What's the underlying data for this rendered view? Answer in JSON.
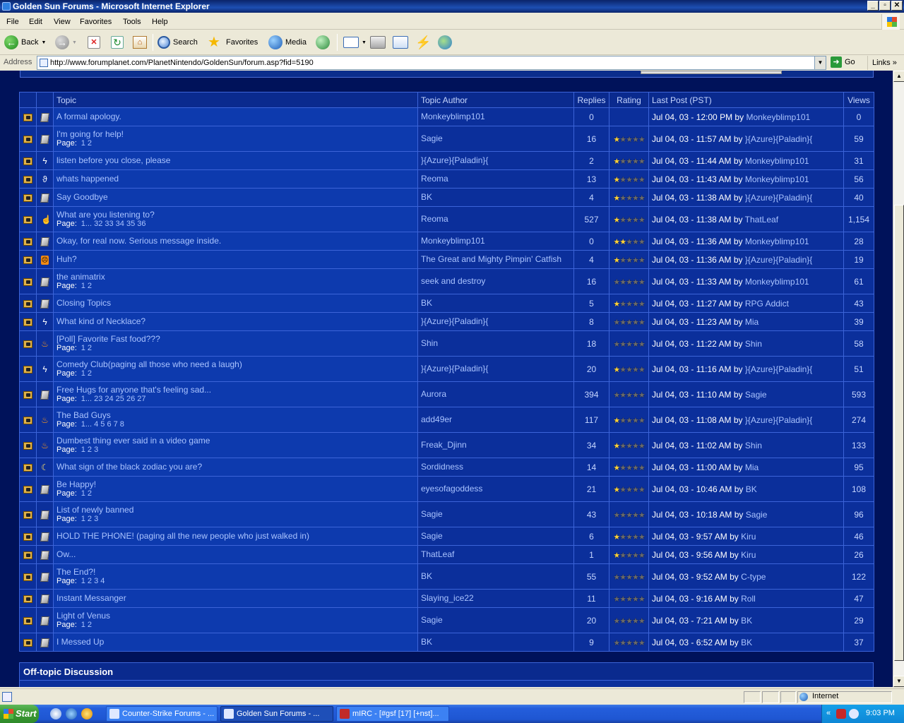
{
  "window": {
    "title": "Golden Sun Forums - Microsoft Internet Explorer",
    "controls": [
      "_",
      "▫",
      "✕"
    ]
  },
  "menu": [
    "File",
    "Edit",
    "View",
    "Favorites",
    "Tools",
    "Help"
  ],
  "toolbar": {
    "back": "Back",
    "search": "Search",
    "favorites": "Favorites",
    "media": "Media"
  },
  "address": {
    "label": "Address",
    "url": "http://www.forumplanet.com/PlanetNintendo/GoldenSun/forum.asp?fid=5190",
    "go": "Go",
    "links": "Links"
  },
  "table": {
    "headers": {
      "topic": "Topic",
      "author": "Topic Author",
      "replies": "Replies",
      "rating": "Rating",
      "lastpost": "Last Post (PST)",
      "views": "Views"
    },
    "page_label": "Page:",
    "by": "by",
    "rows": [
      {
        "icon": "page",
        "title": "A formal apology.",
        "pages": "",
        "author": "Monkeyblimp101",
        "replies": "0",
        "stars": 0,
        "date": "Jul 04, 03 - 12:00 PM",
        "who": "Monkeyblimp101",
        "views": "0"
      },
      {
        "icon": "page",
        "title": "I'm going for help!",
        "pages": "1  2",
        "author": "Sagie",
        "replies": "16",
        "stars": 1,
        "date": "Jul 04, 03 - 11:57 AM",
        "who": "}{Azure}{Paladin}{",
        "views": "59"
      },
      {
        "icon": "lightning",
        "title": "listen before you close, please",
        "pages": "",
        "author": "}{Azure}{Paladin}{",
        "replies": "2",
        "stars": 1,
        "date": "Jul 04, 03 - 11:44 AM",
        "who": "Monkeyblimp101",
        "views": "31"
      },
      {
        "icon": "lightbulb",
        "title": "whats happened",
        "pages": "",
        "author": "Reoma",
        "replies": "13",
        "stars": 1,
        "date": "Jul 04, 03 - 11:43 AM",
        "who": "Monkeyblimp101",
        "views": "56"
      },
      {
        "icon": "page",
        "title": "Say Goodbye",
        "pages": "",
        "author": "BK",
        "replies": "4",
        "stars": 1,
        "date": "Jul 04, 03 - 11:38 AM",
        "who": "}{Azure}{Paladin}{",
        "views": "40"
      },
      {
        "icon": "thumb",
        "title": "What are you listening to?",
        "pages": "1...  32  33  34  35  36",
        "author": "Reoma",
        "replies": "527",
        "stars": 1,
        "date": "Jul 04, 03 - 11:38 AM",
        "who": "ThatLeaf",
        "views": "1,154"
      },
      {
        "icon": "page",
        "title": "Okay, for real now. Serious message inside.",
        "pages": "",
        "author": "Monkeyblimp101",
        "replies": "0",
        "stars": 2,
        "date": "Jul 04, 03 - 11:36 AM",
        "who": "Monkeyblimp101",
        "views": "28"
      },
      {
        "icon": "angry",
        "title": "Huh?",
        "pages": "",
        "author": "The Great and Mighty Pimpin' Catfish",
        "replies": "4",
        "stars": 1,
        "date": "Jul 04, 03 - 11:36 AM",
        "who": "}{Azure}{Paladin}{",
        "views": "19"
      },
      {
        "icon": "page",
        "title": "the animatrix",
        "pages": "1  2",
        "author": "seek and destroy",
        "replies": "16",
        "stars": 0,
        "date": "Jul 04, 03 - 11:33 AM",
        "who": "Monkeyblimp101",
        "views": "61"
      },
      {
        "icon": "page",
        "title": "Closing Topics",
        "pages": "",
        "author": "BK",
        "replies": "5",
        "stars": 1,
        "date": "Jul 04, 03 - 11:27 AM",
        "who": "RPG Addict",
        "views": "43"
      },
      {
        "icon": "lightning",
        "title": "What kind of Necklace?",
        "pages": "",
        "author": "}{Azure}{Paladin}{",
        "replies": "8",
        "stars": 0,
        "date": "Jul 04, 03 - 11:23 AM",
        "who": "Mia",
        "views": "39"
      },
      {
        "icon": "fire",
        "title": "[Poll] Favorite Fast food???",
        "pages": "1  2",
        "author": "Shin",
        "replies": "18",
        "stars": 0,
        "date": "Jul 04, 03 - 11:22 AM",
        "who": "Shin",
        "views": "58"
      },
      {
        "icon": "lightning",
        "title": "Comedy Club(paging all those who need a laugh)",
        "pages": "1  2",
        "author": "}{Azure}{Paladin}{",
        "replies": "20",
        "stars": 1,
        "date": "Jul 04, 03 - 11:16 AM",
        "who": "}{Azure}{Paladin}{",
        "views": "51"
      },
      {
        "icon": "page",
        "title": "Free Hugs for anyone that's feeling sad...",
        "pages": "1...  23  24  25  26  27",
        "author": "Aurora",
        "replies": "394",
        "stars": 0,
        "date": "Jul 04, 03 - 11:10 AM",
        "who": "Sagie",
        "views": "593"
      },
      {
        "icon": "fire",
        "title": "The Bad Guys",
        "pages": "1...  4  5  6  7  8",
        "author": "add49er",
        "replies": "117",
        "stars": 1,
        "date": "Jul 04, 03 - 11:08 AM",
        "who": "}{Azure}{Paladin}{",
        "views": "274"
      },
      {
        "icon": "fire",
        "title": "Dumbest thing ever said in a video game",
        "pages": "1  2  3",
        "author": "Freak_Djinn",
        "replies": "34",
        "stars": 1,
        "date": "Jul 04, 03 - 11:02 AM",
        "who": "Shin",
        "views": "133"
      },
      {
        "icon": "moon",
        "title": "What sign of the black zodiac you are?",
        "pages": "",
        "author": "Sordidness",
        "replies": "14",
        "stars": 1,
        "date": "Jul 04, 03 - 11:00 AM",
        "who": "Mia",
        "views": "95"
      },
      {
        "icon": "page",
        "title": "Be Happy!",
        "pages": "1  2",
        "author": "eyesofagoddess",
        "replies": "21",
        "stars": 1,
        "date": "Jul 04, 03 - 10:46 AM",
        "who": "BK",
        "views": "108"
      },
      {
        "icon": "page",
        "title": "List of newly banned",
        "pages": "1  2  3",
        "author": "Sagie",
        "replies": "43",
        "stars": 0,
        "date": "Jul 04, 03 - 10:18 AM",
        "who": "Sagie",
        "views": "96"
      },
      {
        "icon": "page",
        "title": "HOLD THE PHONE! (paging all the new people who just walked in)",
        "pages": "",
        "author": "Sagie",
        "replies": "6",
        "stars": 1,
        "date": "Jul 04, 03 - 9:57 AM",
        "who": "Kiru",
        "views": "46"
      },
      {
        "icon": "page",
        "title": "Ow...",
        "pages": "",
        "author": "ThatLeaf",
        "replies": "1",
        "stars": 1,
        "date": "Jul 04, 03 - 9:56 AM",
        "who": "Kiru",
        "views": "26"
      },
      {
        "icon": "page",
        "title": "The End?!",
        "pages": "1  2  3  4",
        "author": "BK",
        "replies": "55",
        "stars": 0,
        "date": "Jul 04, 03 - 9:52 AM",
        "who": "C-type",
        "views": "122"
      },
      {
        "icon": "page",
        "title": "Instant Messanger",
        "pages": "",
        "author": "Slaying_ice22",
        "replies": "11",
        "stars": 0,
        "date": "Jul 04, 03 - 9:16 AM",
        "who": "Roll",
        "views": "47"
      },
      {
        "icon": "page",
        "title": "Light of Venus",
        "pages": "1  2",
        "author": "Sagie",
        "replies": "20",
        "stars": 0,
        "date": "Jul 04, 03 - 7:21 AM",
        "who": "BK",
        "views": "29"
      },
      {
        "icon": "page",
        "title": "I Messed Up",
        "pages": "",
        "author": "BK",
        "replies": "9",
        "stars": 0,
        "date": "Jul 04, 03 - 6:52 AM",
        "who": "BK",
        "views": "37"
      }
    ]
  },
  "section_next": {
    "title": "Off-topic Discussion"
  },
  "status": {
    "zone": "Internet"
  },
  "taskbar": {
    "start": "Start",
    "tasks": [
      "Counter-Strike Forums - ...",
      "Golden Sun Forums - ...",
      "mIRC - [#gsf [17] [+nst]..."
    ],
    "clock": "9:03 PM",
    "chevron": "«"
  },
  "colors": {
    "page_bg": "#00125A",
    "row_bg": "#0B2F9B",
    "border": "#3C64D8",
    "link": "#A9C3FF",
    "star_on": "#FFD23A"
  }
}
